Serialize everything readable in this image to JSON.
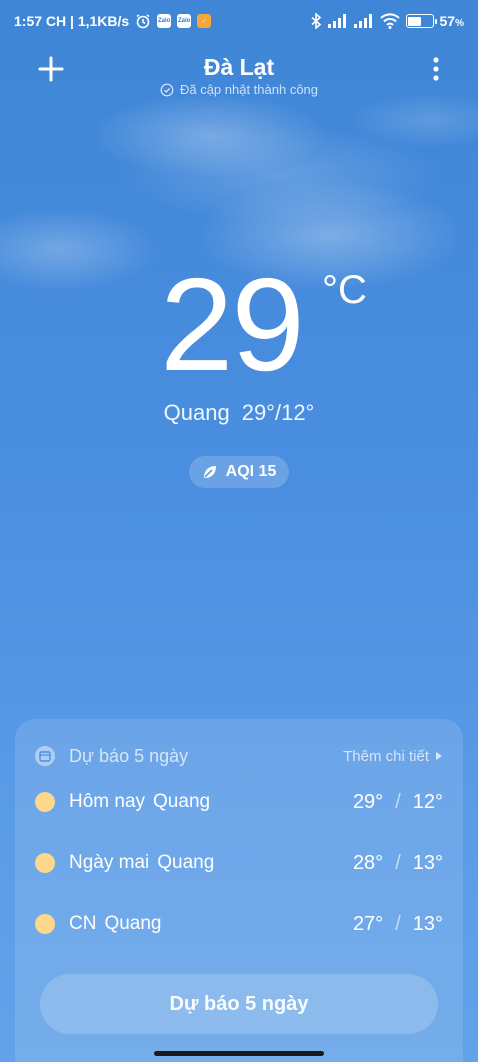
{
  "status_bar": {
    "time_speed": "1:57 CH | 1,1KB/s",
    "battery_level": "57",
    "battery_unit": "%",
    "icons": [
      "alarm-icon",
      "zalo-icon",
      "zalo-icon",
      "app-icon",
      "bluetooth-icon",
      "signal-icon",
      "signal-icon",
      "wifi-icon",
      "battery-icon"
    ]
  },
  "header": {
    "city": "Đà Lạt",
    "update_status": "Đã cập nhật thành công"
  },
  "current": {
    "temperature": "29",
    "unit": "°C",
    "condition": "Quang",
    "high_low": "29°/12°",
    "aqi": "AQI 15"
  },
  "forecast": {
    "title": "Dự báo 5 ngày",
    "more_label": "Thêm chi tiết",
    "rows": [
      {
        "day": "Hôm nay",
        "condition": "Quang",
        "high": "29°",
        "low": "12°"
      },
      {
        "day": "Ngày mai",
        "condition": "Quang",
        "high": "28°",
        "low": "13°"
      },
      {
        "day": "CN",
        "condition": "Quang",
        "high": "27°",
        "low": "13°"
      }
    ],
    "button_label": "Dự báo 5 ngày"
  },
  "colors": {
    "sky": "#4a8ee0",
    "sun": "#fdd78a"
  }
}
